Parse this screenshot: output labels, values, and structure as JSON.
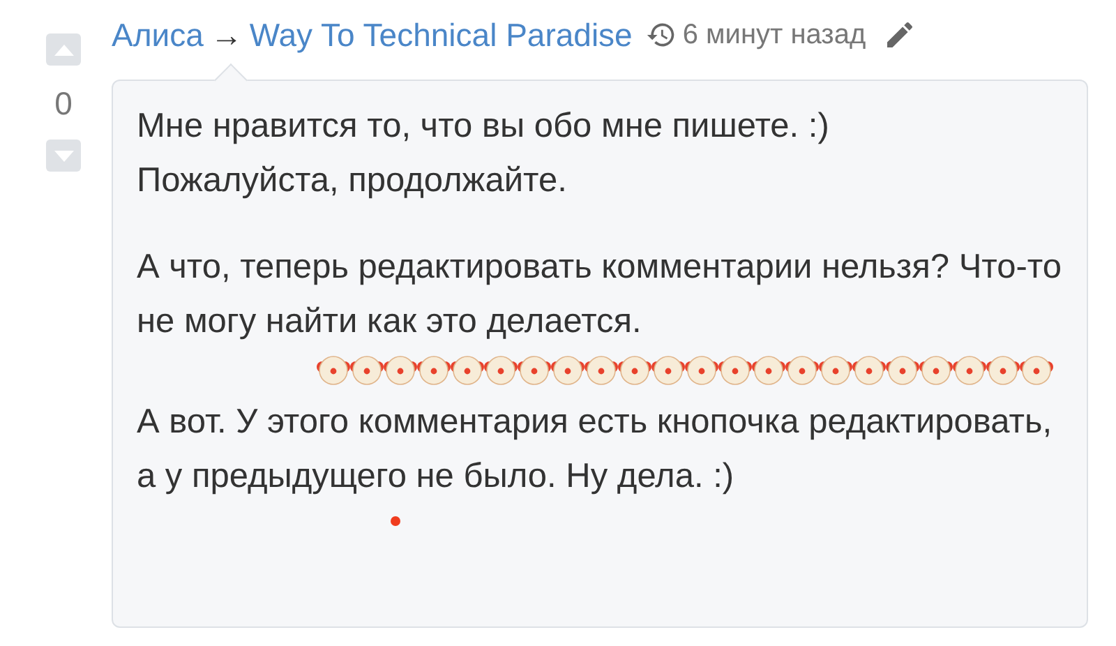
{
  "vote": {
    "score": "0"
  },
  "header": {
    "author": "Алиса",
    "arrow": "→",
    "target": "Way To Technical Paradise",
    "time": "6 минут назад"
  },
  "comment": {
    "blocks": [
      {
        "kind": "text",
        "text": "Мне нравится то, что вы обо мне пишете. :)\nПожалуйста, продолжайте."
      },
      {
        "kind": "text",
        "text": "А что, теперь редактировать комментарии нельзя? Что-то не могу найти как это делается."
      },
      {
        "kind": "emojis",
        "emojis": [
          {
            "kind": "clown"
          },
          {
            "kind": "clown"
          },
          {
            "kind": "clown"
          },
          {
            "kind": "clown"
          },
          {
            "kind": "clown"
          },
          {
            "kind": "clown"
          },
          {
            "kind": "clown"
          },
          {
            "kind": "clown"
          },
          {
            "kind": "clown"
          },
          {
            "kind": "clown"
          },
          {
            "kind": "clown"
          },
          {
            "kind": "clown"
          },
          {
            "kind": "clown"
          },
          {
            "kind": "clown"
          },
          {
            "kind": "clown"
          },
          {
            "kind": "clown"
          },
          {
            "kind": "clown"
          },
          {
            "kind": "clown"
          },
          {
            "kind": "clown"
          },
          {
            "kind": "clown"
          },
          {
            "kind": "clown"
          },
          {
            "kind": "clown"
          }
        ]
      },
      {
        "kind": "text",
        "text": "А вот. У этого комментария есть кнопочка редактировать, а у предыдущего не было. Ну дела. :)"
      }
    ]
  }
}
